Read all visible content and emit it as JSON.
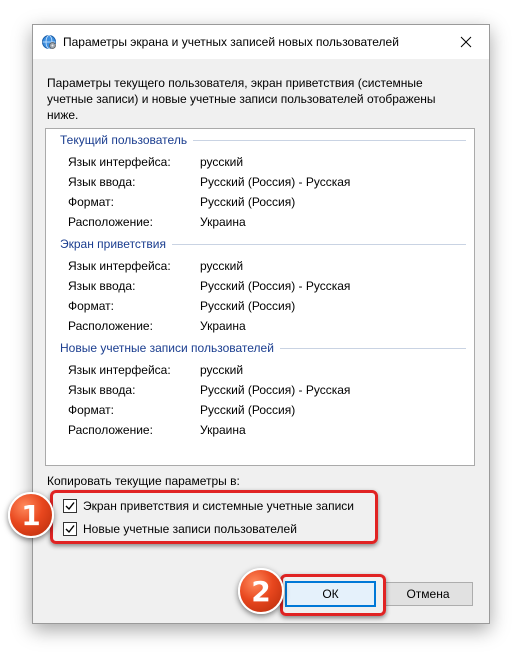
{
  "window": {
    "title": "Параметры экрана и учетных записей новых пользователей",
    "close_label": "✕"
  },
  "description": "Параметры текущего пользователя, экран приветствия (системные учетные записи) и новые учетные записи пользователей отображены ниже.",
  "sections": [
    {
      "title": "Текущий пользователь",
      "rows": [
        {
          "key": "Язык интерфейса:",
          "value": "русский"
        },
        {
          "key": "Язык ввода:",
          "value": "Русский (Россия) - Русская"
        },
        {
          "key": "Формат:",
          "value": "Русский (Россия)"
        },
        {
          "key": "Расположение:",
          "value": "Украина"
        }
      ]
    },
    {
      "title": "Экран приветствия",
      "rows": [
        {
          "key": "Язык интерфейса:",
          "value": "русский"
        },
        {
          "key": "Язык ввода:",
          "value": "Русский (Россия) - Русская"
        },
        {
          "key": "Формат:",
          "value": "Русский (Россия)"
        },
        {
          "key": "Расположение:",
          "value": "Украина"
        }
      ]
    },
    {
      "title": "Новые учетные записи пользователей",
      "rows": [
        {
          "key": "Язык интерфейса:",
          "value": "русский"
        },
        {
          "key": "Язык ввода:",
          "value": "Русский (Россия) - Русская"
        },
        {
          "key": "Формат:",
          "value": "Русский (Россия)"
        },
        {
          "key": "Расположение:",
          "value": "Украина"
        }
      ]
    }
  ],
  "copy": {
    "label": "Копировать текущие параметры в:",
    "options": [
      {
        "label": "Экран приветствия и системные учетные записи",
        "checked": true
      },
      {
        "label": "Новые учетные записи пользователей",
        "checked": true
      }
    ]
  },
  "buttons": {
    "ok": "ОК",
    "cancel": "Отмена"
  },
  "annotations": {
    "badge_1": "1",
    "badge_2": "2",
    "highlight_color": "#e02323",
    "badge_color": "#e8471e"
  },
  "colors": {
    "section_title": "#1a3d8f",
    "default_button_border": "#0078d7"
  }
}
